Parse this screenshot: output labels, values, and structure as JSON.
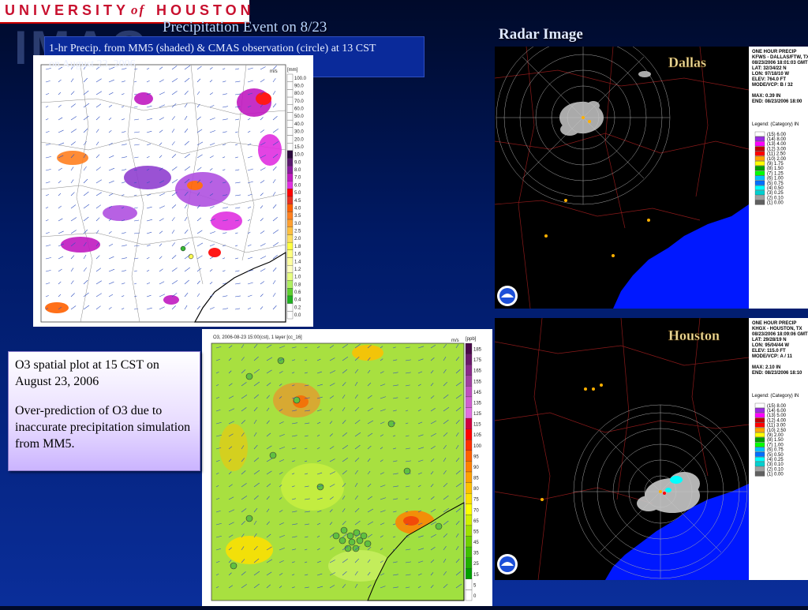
{
  "header": {
    "logo_word1": "UNIVERSITY",
    "logo_of": "of",
    "logo_word2": "HOUSTON",
    "bg_letters": "IMAG",
    "title": "Precipitation Event on 8/23",
    "caption": "1-hr Precip. from MM5 (shaded) & CMAS observation (circle) at 13 CST on August 23, 2006",
    "radar_title": "Radar Image"
  },
  "precip_map": {
    "unit": "[mm]",
    "vector_label": "m/s",
    "scale": [
      "100.0",
      "90.0",
      "80.0",
      "70.0",
      "60.0",
      "50.0",
      "40.0",
      "30.0",
      "20.0",
      "15.0",
      "10.0",
      "9.0",
      "8.0",
      "7.0",
      "6.0",
      "5.0",
      "4.5",
      "4.0",
      "3.5",
      "3.0",
      "2.5",
      "2.0",
      "1.8",
      "1.6",
      "1.4",
      "1.2",
      "1.0",
      "0.8",
      "0.6",
      "0.4",
      "0.2",
      "0.0"
    ]
  },
  "o3_map": {
    "header": "O3, 2006-08-23 15:00(cst), 1 layer [cc_16]",
    "unit": "[ppb]",
    "vector_label": "m/s",
    "scale": [
      "185",
      "175",
      "165",
      "155",
      "145",
      "135",
      "125",
      "115",
      "105",
      "100",
      "95",
      "90",
      "85",
      "80",
      "75",
      "70",
      "65",
      "55",
      "45",
      "35",
      "25",
      "15",
      "5",
      "0"
    ]
  },
  "dallas": {
    "city": "Dallas",
    "info": [
      "ONE HOUR PRECIP",
      "KFWS - DALLAS/FTW, TX",
      "08/23/2006 18:01:03 GMT",
      "LAT: 32/34/22 N",
      "LON: 97/18/10 W",
      "ELEV: 764.0 FT",
      "MODE/VCP: B / 32",
      "",
      "MAX: 0.39 IN",
      "END: 08/23/2006 18:00"
    ],
    "legend_title": "Legend: (Category) IN",
    "legend": [
      "(15) 6.00",
      "(14) 8.00",
      "(13) 4.00",
      "(12) 3.00",
      "(11) 2.50",
      "(10) 2.00",
      "(9) 1.75",
      "(8) 1.50",
      "(7) 1.25",
      "(6) 1.00",
      "(5) 0.75",
      "(4) 0.50",
      "(3) 0.25",
      "(2) 0.10",
      "(1) 0.00"
    ]
  },
  "houston": {
    "city": "Houston",
    "info": [
      "ONE HOUR PRECIP",
      "KHGX - HOUSTON, TX",
      "08/23/2006 18:09:06 GMT",
      "LAT: 29/28/19 N",
      "LON: 95/04/44 W",
      "ELEV: 115.0 FT",
      "MODE/VCP: A / 11",
      "",
      "MAX: 2.10 IN",
      "END: 08/23/2006 18:10"
    ],
    "legend_title": "Legend: (Category) IN",
    "legend": [
      "(15) 8.00",
      "(14) 6.00",
      "(13) 5.00",
      "(12) 4.00",
      "(11) 3.00",
      "(10) 2.50",
      "(9) 2.00",
      "(8) 1.50",
      "(7) 1.00",
      "(6) 0.75",
      "(5) 0.50",
      "(4) 0.25",
      "(3) 0.10",
      "(2) 0.10",
      "(1) 0.00"
    ]
  },
  "o3_note": {
    "p1": "O3 spatial plot at 15 CST on August 23, 2006",
    "p2": "Over-prediction of  O3 due to inaccurate precipitation simulation from MM5."
  },
  "colors": {
    "precip_scale": [
      "#ffffff",
      "#ffffff",
      "#ffffff",
      "#ffffff",
      "#ffffff",
      "#ffffff",
      "#ffffff",
      "#ffffff",
      "#ffffff",
      "#ffffff",
      "#2b0a3d",
      "#5a1a6e",
      "#8a1a9e",
      "#c01ac0",
      "#e030e0",
      "#ff0000",
      "#e83020",
      "#ff6000",
      "#ff8020",
      "#ffa030",
      "#ffc040",
      "#ffe060",
      "#ffff40",
      "#ffff80",
      "#ffffa0",
      "#ffffc0",
      "#e8ff80",
      "#b0f060",
      "#60d030",
      "#20b020",
      "#ffffff"
    ],
    "o3_scale": [
      "#4a0a4a",
      "#6a1a6a",
      "#8a2a8a",
      "#a040a0",
      "#c050c0",
      "#d060d0",
      "#e070e0",
      "#d00040",
      "#ff0000",
      "#ff3000",
      "#ff6000",
      "#ff8000",
      "#ffa000",
      "#ffc000",
      "#ffe000",
      "#ffff00",
      "#d0f000",
      "#a0e000",
      "#70d000",
      "#40c000",
      "#20b000",
      "#00a000",
      "#ffffff"
    ],
    "dallas_legend": [
      "#ffffff",
      "#9a2be2",
      "#ff00ff",
      "#c00000",
      "#ff0000",
      "#ffa500",
      "#ffff00",
      "#00a000",
      "#00ff00",
      "#00c0ff",
      "#0070ff",
      "#00ffff",
      "#00d0d0",
      "#a0a0a0",
      "#606060"
    ],
    "houston_legend": [
      "#ffffff",
      "#9a2be2",
      "#ff00ff",
      "#c00000",
      "#ff0000",
      "#ffa500",
      "#ffff00",
      "#00a000",
      "#00ff00",
      "#00c0ff",
      "#0070ff",
      "#00ffff",
      "#00d0d0",
      "#a0a0a0",
      "#606060"
    ]
  }
}
